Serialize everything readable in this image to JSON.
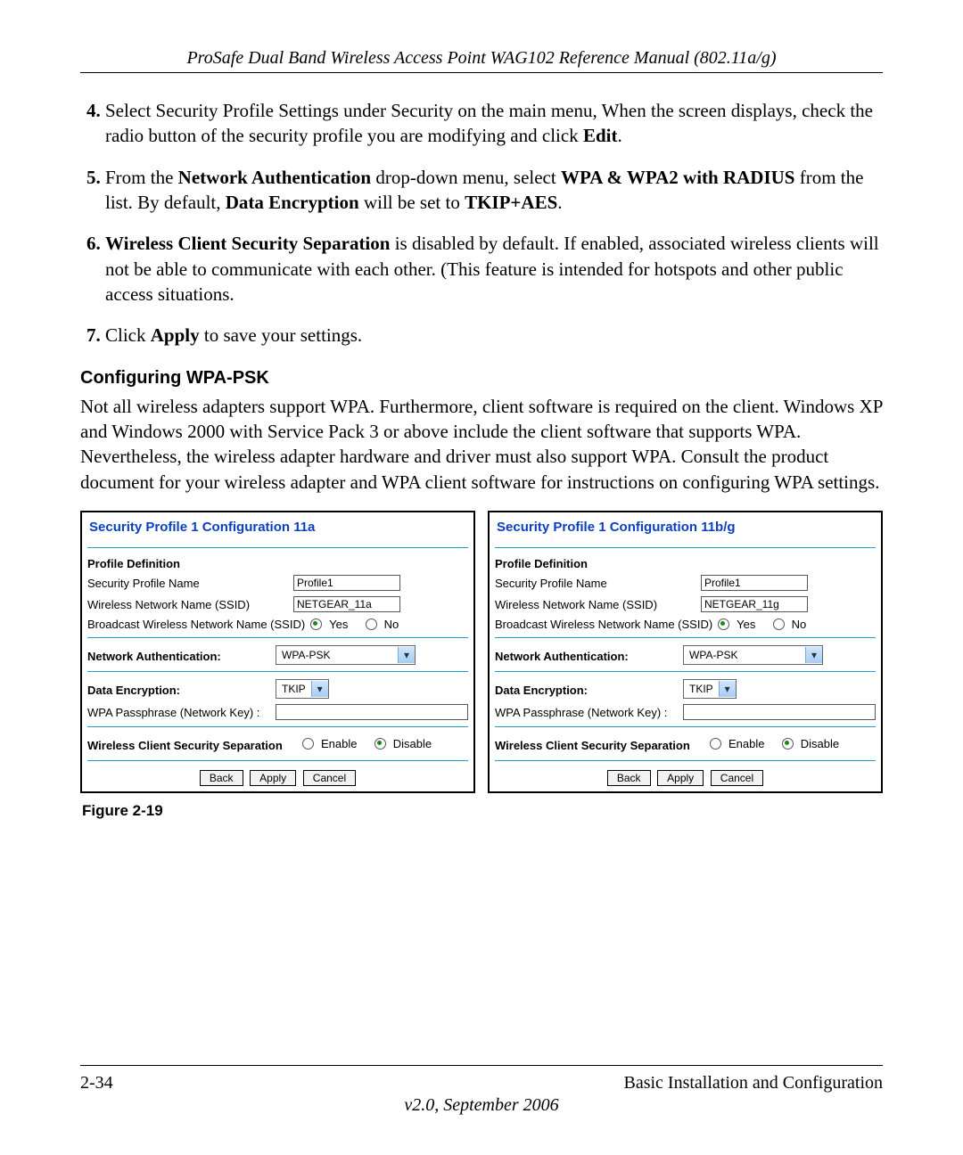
{
  "header": {
    "running_title": "ProSafe Dual Band Wireless Access Point WAG102 Reference Manual (802.11a/g)"
  },
  "steps": {
    "start": 4,
    "items": [
      {
        "pre": "",
        "mid": "",
        "post": "Select Security Profile Settings under Security on the main menu, When the screen displays, check the radio button of the security profile you are modifying and click ",
        "bold_tail": "Edit",
        "tail": "."
      },
      {
        "pre": "From the ",
        "b1": "Network Authentication",
        "mid1": " drop-down menu, select ",
        "b2": "WPA & WPA2 with RADIUS",
        "mid2": " from the list. By default, ",
        "b3": "Data Encryption",
        "mid3": " will be set to ",
        "b4": "TKIP+AES",
        "tail": "."
      },
      {
        "b1": "Wireless Client Security Separation",
        "mid1": " is disabled by default. If enabled, associated wireless clients will not be able to communicate with each other. (This feature is intended for hotspots and other public access situations."
      },
      {
        "pre": "Click ",
        "b1": "Apply",
        "mid1": " to save your settings."
      }
    ]
  },
  "subhead": "Configuring WPA-PSK",
  "paragraph": "Not all wireless adapters support WPA. Furthermore, client software is required on the client. Windows XP and Windows 2000 with Service Pack 3 or above include the client software that supports WPA. Nevertheless, the wireless adapter hardware and driver must also support WPA. Consult the product document for your wireless adapter and WPA client software for instructions on configuring WPA settings.",
  "panels": [
    {
      "title": "Security Profile 1 Configuration 11a",
      "profile_def": "Profile Definition",
      "rows": {
        "name_label": "Security Profile Name",
        "name_value": "Profile1",
        "ssid_label": "Wireless Network Name (SSID)",
        "ssid_value": "NETGEAR_11a",
        "bcast_label": "Broadcast Wireless Network Name (SSID)",
        "yes": "Yes",
        "no": "No"
      },
      "auth_label": "Network Authentication:",
      "auth_value": "WPA-PSK",
      "enc_label": "Data Encryption:",
      "enc_value": "TKIP",
      "pass_label": "WPA Passphrase (Network Key) :",
      "pass_value": "",
      "sep_label": "Wireless Client Security Separation",
      "enable": "Enable",
      "disable": "Disable",
      "buttons": {
        "back": "Back",
        "apply": "Apply",
        "cancel": "Cancel"
      }
    },
    {
      "title": "Security Profile 1 Configuration 11b/g",
      "profile_def": "Profile Definition",
      "rows": {
        "name_label": "Security Profile Name",
        "name_value": "Profile1",
        "ssid_label": "Wireless Network Name (SSID)",
        "ssid_value": "NETGEAR_11g",
        "bcast_label": "Broadcast Wireless Network Name (SSID)",
        "yes": "Yes",
        "no": "No"
      },
      "auth_label": "Network Authentication:",
      "auth_value": "WPA-PSK",
      "enc_label": "Data Encryption:",
      "enc_value": "TKIP",
      "pass_label": "WPA Passphrase (Network Key) :",
      "pass_value": "",
      "sep_label": "Wireless Client Security Separation",
      "enable": "Enable",
      "disable": "Disable",
      "buttons": {
        "back": "Back",
        "apply": "Apply",
        "cancel": "Cancel"
      }
    }
  ],
  "figure_caption": "Figure 2-19",
  "footer": {
    "page_num": "2-34",
    "chapter": "Basic Installation and Configuration",
    "version": "v2.0, September 2006"
  }
}
